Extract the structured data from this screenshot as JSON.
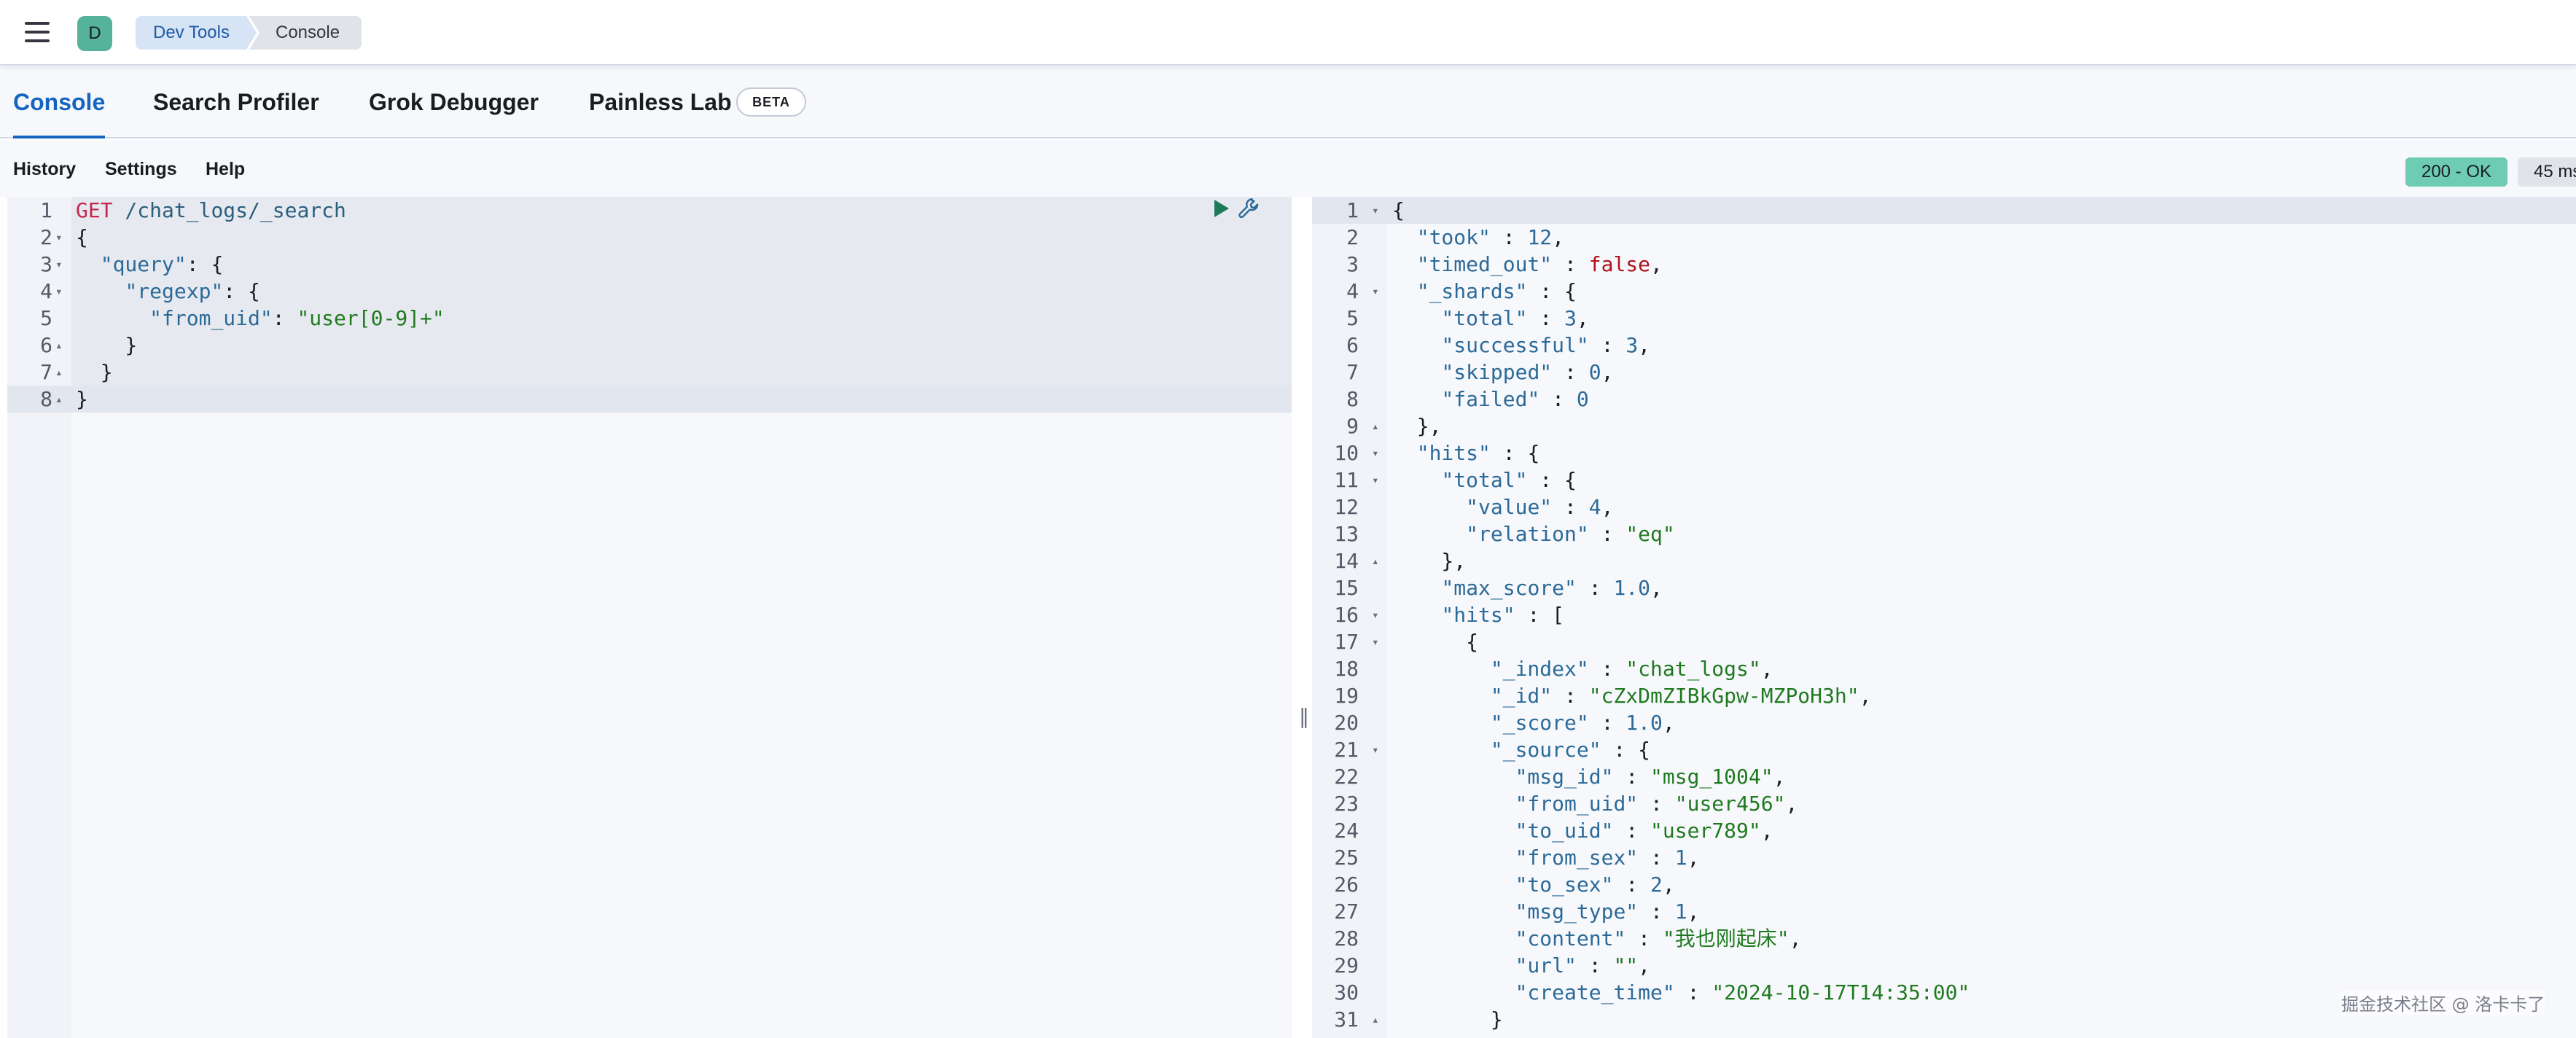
{
  "header": {
    "avatar_letter": "D",
    "breadcrumbs": [
      "Dev Tools",
      "Console"
    ]
  },
  "tabs": [
    {
      "label": "Console",
      "active": true
    },
    {
      "label": "Search Profiler",
      "active": false
    },
    {
      "label": "Grok Debugger",
      "active": false
    },
    {
      "label": "Painless Lab",
      "active": false
    }
  ],
  "beta_badge": "BETA",
  "actions": {
    "history": "History",
    "settings": "Settings",
    "help": "Help"
  },
  "response_status": {
    "status": "200 - OK",
    "time": "45 ms"
  },
  "request": {
    "method": "GET",
    "path": " /chat_logs/_search",
    "lines": [
      "{",
      "  \"query\": {",
      "    \"regexp\": {",
      "      \"from_uid\": \"user[0-9]+\"",
      "    }",
      "  }",
      "}"
    ]
  },
  "response": {
    "lines": [
      "{",
      "  \"took\" : 12,",
      "  \"timed_out\" : false,",
      "  \"_shards\" : {",
      "    \"total\" : 3,",
      "    \"successful\" : 3,",
      "    \"skipped\" : 0,",
      "    \"failed\" : 0",
      "  },",
      "  \"hits\" : {",
      "    \"total\" : {",
      "      \"value\" : 4,",
      "      \"relation\" : \"eq\"",
      "    },",
      "    \"max_score\" : 1.0,",
      "    \"hits\" : [",
      "      {",
      "        \"_index\" : \"chat_logs\",",
      "        \"_id\" : \"cZxDmZIBkGpw-MZPoH3h\",",
      "        \"_score\" : 1.0,",
      "        \"_source\" : {",
      "          \"msg_id\" : \"msg_1004\",",
      "          \"from_uid\" : \"user456\",",
      "          \"to_uid\" : \"user789\",",
      "          \"from_sex\" : 1,",
      "          \"to_sex\" : 2,",
      "          \"msg_type\" : 1,",
      "          \"content\" : \"我也刚起床\",",
      "          \"url\" : \"\",",
      "          \"create_time\" : \"2024-10-17T14:35:00\"",
      "        }"
    ]
  },
  "watermark": "掘金技术社区 @ 洛卡卡了",
  "colors": {
    "active_tab": "#1565c0",
    "status_ok": "#6dccb1",
    "string": "#1f7a1f",
    "keyword": "#c7254e",
    "boolean": "#b0121e"
  },
  "icons": [
    "hamburger-menu-icon",
    "run-request-icon",
    "wrench-icon",
    "resize-handle-icon"
  ]
}
